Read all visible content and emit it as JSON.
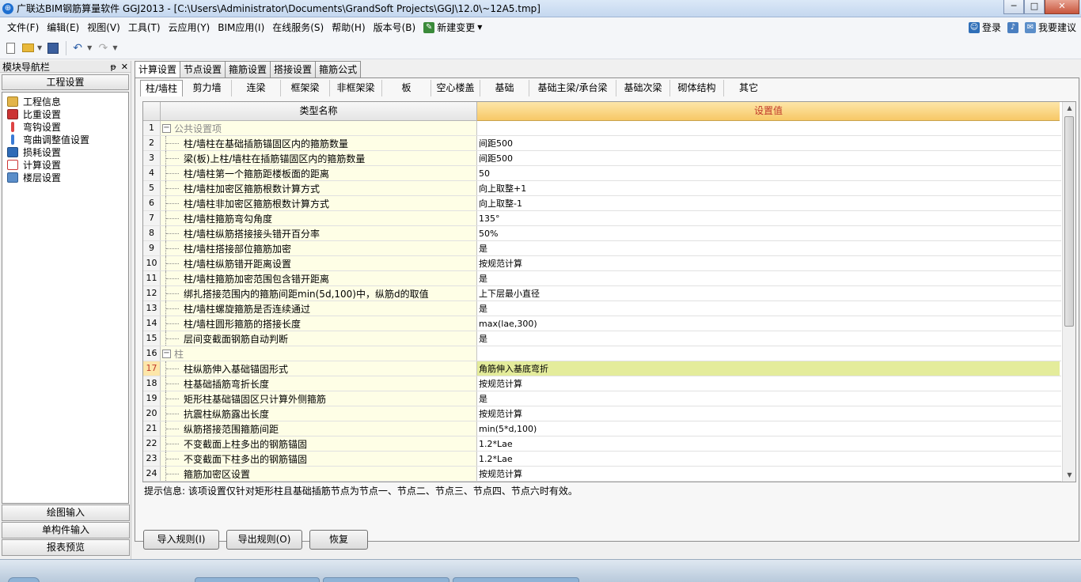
{
  "window": {
    "title": "广联达BIM钢筋算量软件 GGJ2013 - [C:\\Users\\Administrator\\Documents\\GrandSoft Projects\\GGJ\\12.0\\~12A5.tmp]",
    "app_icon": "⊕",
    "minimize": "─",
    "maximize": "□",
    "close": "✕"
  },
  "menu": {
    "items": [
      "文件(F)",
      "编辑(E)",
      "视图(V)",
      "工具(T)",
      "云应用(Y)",
      "BIM应用(I)",
      "在线服务(S)",
      "帮助(H)",
      "版本号(B)"
    ],
    "new_change": "新建变更",
    "login": "登录",
    "suggest": "我要建议"
  },
  "left_panel": {
    "title": "模块导航栏",
    "pin": "ᵽ",
    "close": "✕",
    "group": "工程设置",
    "tree": [
      "工程信息",
      "比重设置",
      "弯钩设置",
      "弯曲调整值设置",
      "损耗设置",
      "计算设置",
      "楼层设置"
    ],
    "bottom": [
      "绘图输入",
      "单构件输入",
      "报表预览"
    ]
  },
  "tabs_top": [
    "计算设置",
    "节点设置",
    "箍筋设置",
    "搭接设置",
    "箍筋公式"
  ],
  "tabs_sub": [
    "柱/墙柱",
    "剪力墙",
    "连梁",
    "框架梁",
    "非框架梁",
    "板",
    "空心楼盖",
    "基础",
    "基础主梁/承台梁",
    "基础次梁",
    "砌体结构",
    "其它"
  ],
  "grid": {
    "col_name": "类型名称",
    "col_value": "设置值",
    "rows": [
      {
        "num": "1",
        "name": "公共设置项",
        "value": "",
        "group": true
      },
      {
        "num": "2",
        "name": "柱/墙柱在基础插筋锚固区内的箍筋数量",
        "value": "间距500"
      },
      {
        "num": "3",
        "name": "梁(板)上柱/墙柱在插筋锚固区内的箍筋数量",
        "value": "间距500"
      },
      {
        "num": "4",
        "name": "柱/墙柱第一个箍筋距楼板面的距离",
        "value": "50"
      },
      {
        "num": "5",
        "name": "柱/墙柱加密区箍筋根数计算方式",
        "value": "向上取整+1"
      },
      {
        "num": "6",
        "name": "柱/墙柱非加密区箍筋根数计算方式",
        "value": "向上取整-1"
      },
      {
        "num": "7",
        "name": "柱/墙柱箍筋弯勾角度",
        "value": "135°"
      },
      {
        "num": "8",
        "name": "柱/墙柱纵筋搭接接头错开百分率",
        "value": "50%"
      },
      {
        "num": "9",
        "name": "柱/墙柱搭接部位箍筋加密",
        "value": "是"
      },
      {
        "num": "10",
        "name": "柱/墙柱纵筋错开距离设置",
        "value": "按规范计算"
      },
      {
        "num": "11",
        "name": "柱/墙柱箍筋加密范围包含错开距离",
        "value": "是"
      },
      {
        "num": "12",
        "name": "绑扎搭接范围内的箍筋间距min(5d,100)中，纵筋d的取值",
        "value": "上下层最小直径"
      },
      {
        "num": "13",
        "name": "柱/墙柱螺旋箍筋是否连续通过",
        "value": "是"
      },
      {
        "num": "14",
        "name": "柱/墙柱圆形箍筋的搭接长度",
        "value": "max(lae,300)"
      },
      {
        "num": "15",
        "name": "层间变截面钢筋自动判断",
        "value": "是"
      },
      {
        "num": "16",
        "name": "柱",
        "value": "",
        "group": true
      },
      {
        "num": "17",
        "name": "柱纵筋伸入基础锚固形式",
        "value": "角筋伸入基底弯折",
        "selected": true
      },
      {
        "num": "18",
        "name": "柱基础插筋弯折长度",
        "value": "按规范计算"
      },
      {
        "num": "19",
        "name": "矩形柱基础锚固区只计算外侧箍筋",
        "value": "是"
      },
      {
        "num": "20",
        "name": "抗震柱纵筋露出长度",
        "value": "按规范计算"
      },
      {
        "num": "21",
        "name": "纵筋搭接范围箍筋间距",
        "value": "min(5*d,100)"
      },
      {
        "num": "22",
        "name": "不变截面上柱多出的钢筋锚固",
        "value": "1.2*Lae"
      },
      {
        "num": "23",
        "name": "不变截面下柱多出的钢筋锚固",
        "value": "1.2*Lae"
      },
      {
        "num": "24",
        "name": "箍筋加密区设置",
        "value": "按规范计算"
      }
    ]
  },
  "hint": "提示信息: 该项设置仅针对矩形柱且基础插筋节点为节点一、节点二、节点三、节点四、节点六时有效。",
  "buttons": {
    "import": "导入规则(I)",
    "export": "导出规则(O)",
    "restore": "恢复"
  },
  "colors": {
    "header_value": "#f7c866",
    "selected_value": "#e4ec9b",
    "name_cell": "#fefee6"
  }
}
